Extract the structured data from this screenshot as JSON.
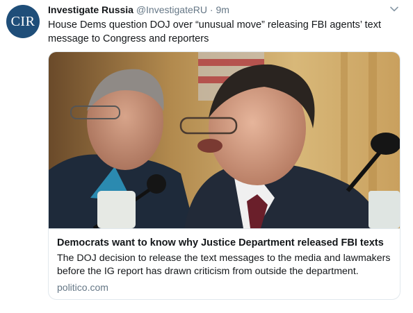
{
  "tweet": {
    "avatar_text": "CIR",
    "display_name": "Investigate Russia",
    "handle": "@InvestigateRU",
    "separator": "·",
    "time": "9m",
    "text": "House Dems question DOJ over “unusual move” releasing FBI agents’ text message to Congress and reporters"
  },
  "card": {
    "title": "Democrats want to know why Justice Department released FBI texts",
    "description": "The DOJ decision to release the text messages to the media and lawmakers before the IG report has drawn criticism from outside the department.",
    "domain": "politico.com"
  },
  "icons": {
    "menu": "chevron-down-icon"
  }
}
